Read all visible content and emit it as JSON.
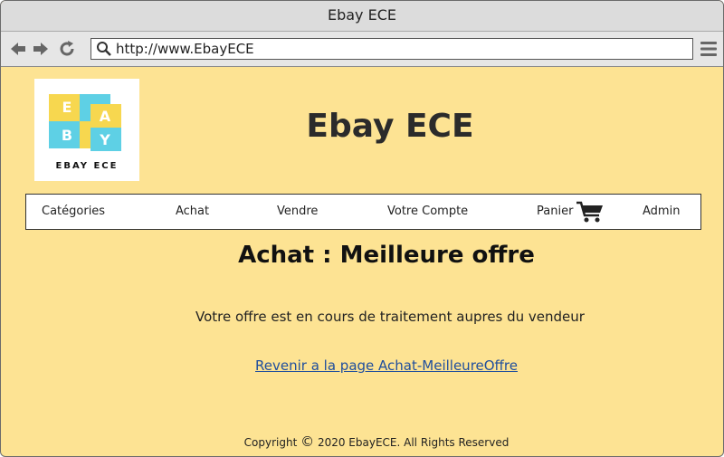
{
  "window": {
    "title": "Ebay ECE"
  },
  "browser": {
    "url": "http://www.EbayECE"
  },
  "logo": {
    "tiles": [
      "E",
      "A",
      "B",
      "Y"
    ],
    "caption": "EBAY ECE",
    "colors": {
      "yellow": "#f7d74f",
      "cyan": "#5ed0e5"
    }
  },
  "header": {
    "site_title": "Ebay ECE"
  },
  "menu": {
    "categories": "Catégories",
    "achat": "Achat",
    "vendre": "Vendre",
    "compte": "Votre Compte",
    "panier": "Panier",
    "admin": "Admin"
  },
  "main": {
    "heading": "Achat : Meilleure offre",
    "message": "Votre offre est en cours de traitement aupres du vendeur",
    "back_link": "Revenir a la page Achat-MeilleureOffre"
  },
  "footer": {
    "prefix": "Copyright",
    "copyright_symbol": "©",
    "text": "2020 EbayECE. All Rights Reserved"
  },
  "colors": {
    "page_background": "#fde393",
    "link": "#1f4e9d"
  }
}
